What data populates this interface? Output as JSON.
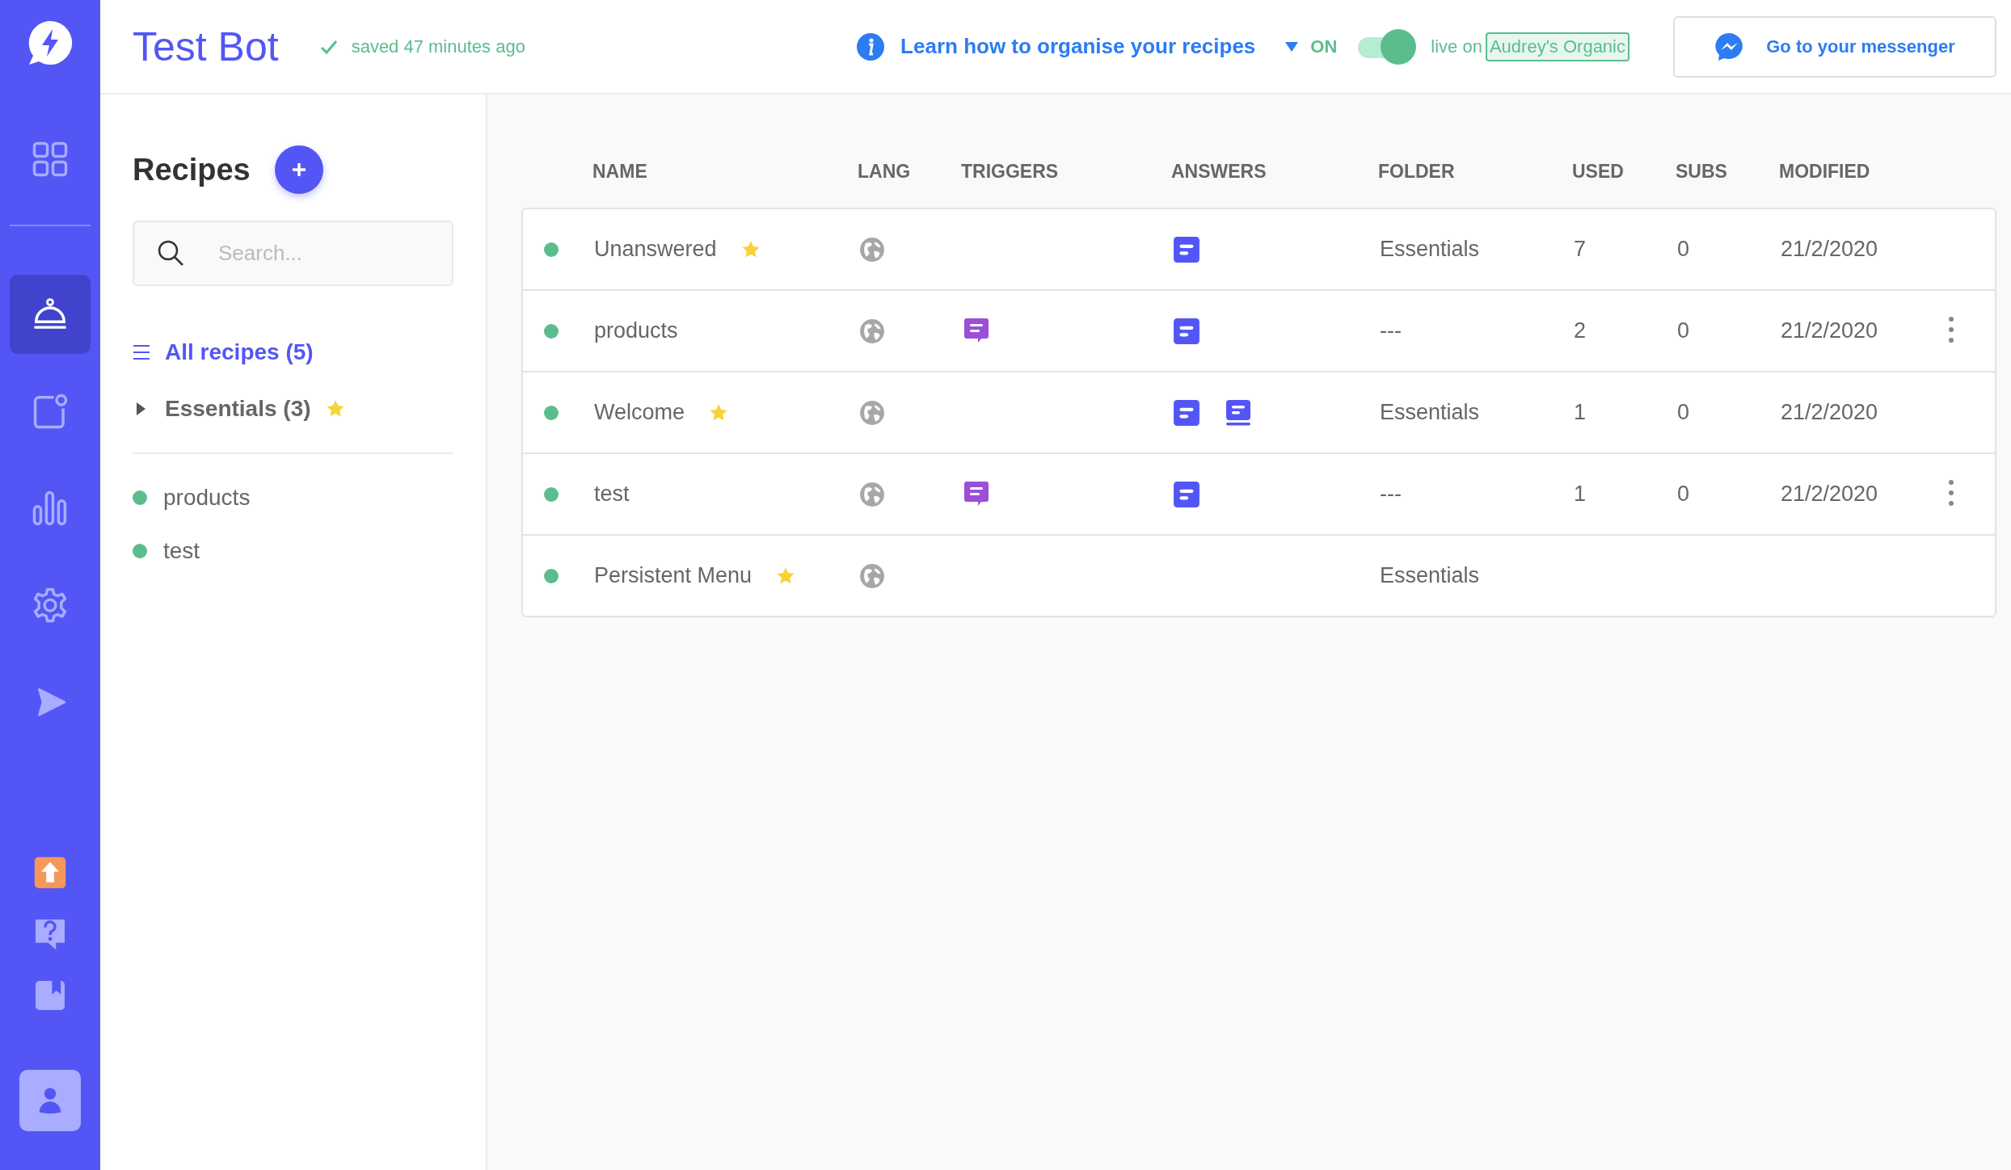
{
  "sidebar": {
    "nav": [
      {
        "kind": "dashboard",
        "selected": false
      },
      {
        "kind": "recipes",
        "selected": true
      },
      {
        "kind": "inbox",
        "selected": false
      },
      {
        "kind": "stats",
        "selected": false
      },
      {
        "kind": "settings",
        "selected": false
      },
      {
        "kind": "broadcast",
        "selected": false
      }
    ],
    "bottom": [
      {
        "kind": "upgrade"
      },
      {
        "kind": "help"
      },
      {
        "kind": "docs"
      },
      {
        "kind": "profile"
      }
    ]
  },
  "header": {
    "title": "Test Bot",
    "saved": "saved 47 minutes ago",
    "help_link": "Learn how to organise your recipes",
    "status": {
      "label": "ON",
      "on": true
    },
    "live_on": "live on",
    "page": "Audrey's Organic",
    "messenger_button": "Go to your messenger"
  },
  "recipes_panel": {
    "title": "Recipes",
    "search": {
      "placeholder": "Search..."
    },
    "folders": [
      {
        "label": "All recipes (5)",
        "selected": true,
        "kind": "all"
      },
      {
        "label": "Essentials (3)",
        "selected": false,
        "kind": "folder",
        "expanded": false,
        "starred": true
      }
    ],
    "recipes": [
      {
        "name": "products",
        "active": true
      },
      {
        "name": "test",
        "active": true
      }
    ]
  },
  "table": {
    "columns": [
      "NAME",
      "LANG",
      "TRIGGERS",
      "ANSWERS",
      "FOLDER",
      "USED",
      "SUBS",
      "MODIFIED"
    ],
    "rows": [
      {
        "active": true,
        "name": "Unanswered",
        "starred": true,
        "answers": [
          {
            "kind": "text"
          }
        ],
        "folder": "Essentials",
        "used": "7",
        "subs": "0",
        "modified": "21/2/2020",
        "menu": false
      },
      {
        "active": true,
        "name": "products",
        "starred": false,
        "triggers": [
          {
            "kind": "message"
          }
        ],
        "answers": [
          {
            "kind": "text"
          }
        ],
        "folder": "---",
        "used": "2",
        "subs": "0",
        "modified": "21/2/2020",
        "menu": true
      },
      {
        "active": true,
        "name": "Welcome",
        "starred": true,
        "answers": [
          {
            "kind": "text"
          },
          {
            "kind": "card"
          }
        ],
        "folder": "Essentials",
        "used": "1",
        "subs": "0",
        "modified": "21/2/2020",
        "menu": false
      },
      {
        "active": true,
        "name": "test",
        "starred": false,
        "triggers": [
          {
            "kind": "message"
          }
        ],
        "answers": [
          {
            "kind": "text"
          }
        ],
        "folder": "---",
        "used": "1",
        "subs": "0",
        "modified": "21/2/2020",
        "menu": true
      },
      {
        "active": true,
        "name": "Persistent Menu",
        "starred": true,
        "folder": "Essentials",
        "menu": false
      }
    ]
  }
}
